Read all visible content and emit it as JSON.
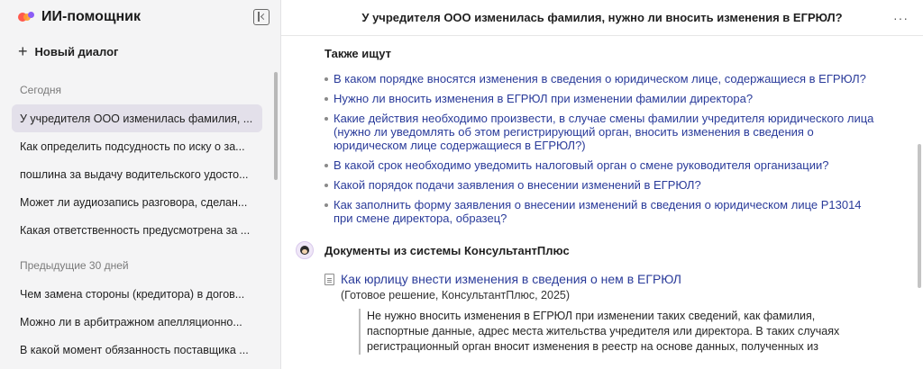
{
  "app": {
    "title": "ИИ-помощник"
  },
  "sidebar": {
    "new_chat": "Новый диалог",
    "groups": [
      {
        "title": "Сегодня",
        "items": [
          {
            "label": "У учредителя ООО изменилась фамилия, ..."
          },
          {
            "label": "Как определить подсудность по иску о за..."
          },
          {
            "label": "пошлина за выдачу водительского удосто..."
          },
          {
            "label": "Может ли аудиозапись разговора, сделан..."
          },
          {
            "label": "Какая ответственность предусмотрена за ..."
          }
        ]
      },
      {
        "title": "Предыдущие 30 дней",
        "items": [
          {
            "label": "Чем замена стороны (кредитора) в догов..."
          },
          {
            "label": "Можно ли в арбитражном апелляционно..."
          },
          {
            "label": "В какой момент обязанность поставщика ..."
          }
        ]
      }
    ]
  },
  "conversation": {
    "title": "У учредителя ООО изменилась фамилия, нужно ли вносить изменения в ЕГРЮЛ?",
    "also_searched": {
      "title": "Также ищут",
      "items": [
        "В каком порядке вносятся изменения в сведения о юридическом лице, содержащиеся в ЕГРЮЛ?",
        "Нужно ли вносить изменения в ЕГРЮЛ при изменении фамилии директора?",
        "Какие действия необходимо произвести, в случае смены фамилии учредителя юридического лица (нужно ли уведомлять об этом регистрирующий орган, вносить изменения в сведения о юридическом лице содержащиеся в ЕГРЮЛ?)",
        "В какой срок необходимо уведомить налоговый орган о смене руководителя организации?",
        "Какой порядок подачи заявления о внесении изменений в ЕГРЮЛ?",
        "Как заполнить форму заявления о внесении изменений в сведения о юридическом лице Р13014 при смене директора, образец?"
      ]
    },
    "documents": {
      "title": "Документы из системы КонсультантПлюс",
      "items": [
        {
          "link": "Как юрлицу внести изменения в сведения о нем в ЕГРЮЛ",
          "source": "(Готовое решение, КонсультантПлюс, 2025)",
          "excerpt": "Не нужно вносить изменения в ЕГРЮЛ при изменении таких сведений, как фамилия, паспортные данные, адрес места жительства учредителя или директора. В таких случаях регистрационный орган вносит изменения в реестр на основе данных, полученных из"
        }
      ]
    }
  },
  "colors": {
    "link": "#2a3b9a",
    "active_item": "#e3e0ea",
    "sidebar_bg": "#f4f4f5"
  }
}
